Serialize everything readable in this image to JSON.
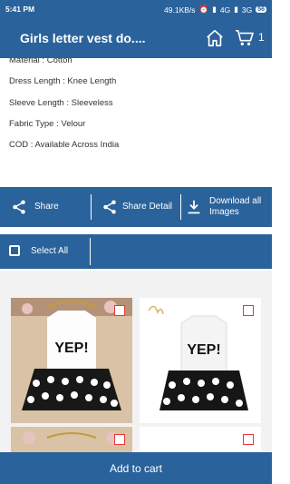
{
  "status": {
    "time": "5:41 PM",
    "net_speed": "49.1KB/s",
    "net1": "4G",
    "net2": "3G",
    "battery": "56"
  },
  "appbar": {
    "title": "Girls letter vest do....",
    "cart_count": "1"
  },
  "details": [
    "Material : Cotton",
    "Dress Length : Knee Length",
    "Sleeve Length : Sleeveless",
    "Fabric Type : Velour",
    "COD : Available Across India"
  ],
  "actions": {
    "share": "Share",
    "share_detail": "Share Detail",
    "download_line1": "Download all",
    "download_line2": "Images"
  },
  "select_all": "Select All",
  "product_text": "YEP!",
  "add_to_cart": "Add to cart",
  "colors": {
    "primary": "#2a629b",
    "accent_checkbox": "#e53935"
  }
}
